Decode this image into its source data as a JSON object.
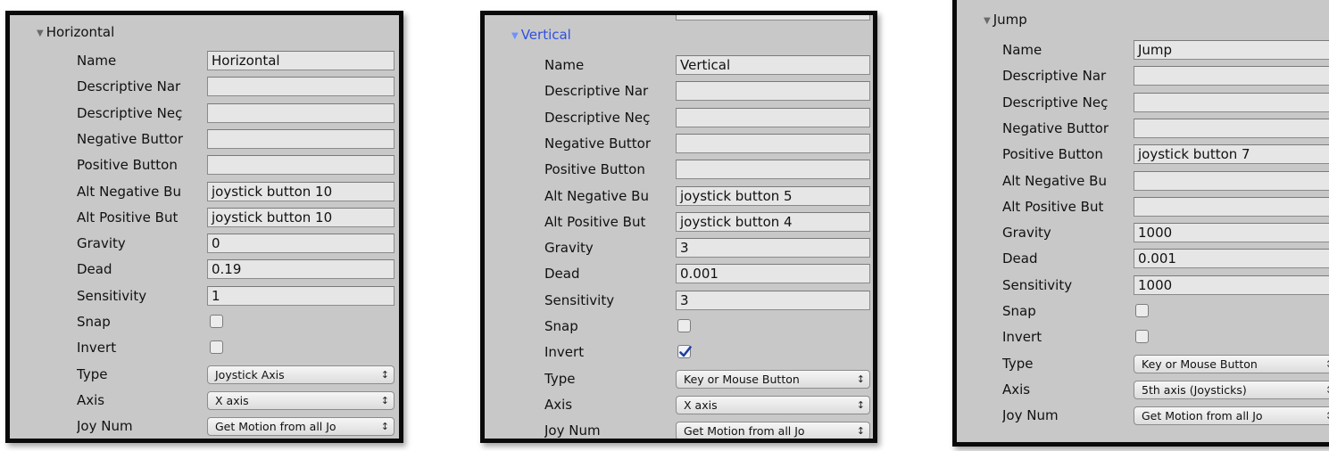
{
  "panels": [
    {
      "header": "Horizontal",
      "header_color": "#111111",
      "rows": [
        {
          "label": "Name",
          "kind": "text",
          "value": "Horizontal"
        },
        {
          "label": "Descriptive Nar",
          "kind": "text",
          "value": ""
        },
        {
          "label": "Descriptive Neç",
          "kind": "text",
          "value": ""
        },
        {
          "label": "Negative Buttor",
          "kind": "text",
          "value": ""
        },
        {
          "label": "Positive Button",
          "kind": "text",
          "value": ""
        },
        {
          "label": "Alt Negative Bu",
          "kind": "text",
          "value": "joystick button 10"
        },
        {
          "label": "Alt Positive But",
          "kind": "text",
          "value": "joystick button 10"
        },
        {
          "label": "Gravity",
          "kind": "text",
          "value": "0"
        },
        {
          "label": "Dead",
          "kind": "text",
          "value": "0.19"
        },
        {
          "label": "Sensitivity",
          "kind": "text",
          "value": "1"
        },
        {
          "label": "Snap",
          "kind": "check",
          "checked": false
        },
        {
          "label": "Invert",
          "kind": "check",
          "checked": false
        },
        {
          "label": "Type",
          "kind": "select",
          "value": "Joystick Axis"
        },
        {
          "label": "Axis",
          "kind": "select",
          "value": "X axis"
        },
        {
          "label": "Joy Num",
          "kind": "select",
          "value": "Get Motion from all Jo"
        }
      ]
    },
    {
      "header": "Vertical",
      "header_color": "#2f4fe0",
      "rows": [
        {
          "label": "Name",
          "kind": "text",
          "value": "Vertical"
        },
        {
          "label": "Descriptive Nar",
          "kind": "text",
          "value": ""
        },
        {
          "label": "Descriptive Neç",
          "kind": "text",
          "value": ""
        },
        {
          "label": "Negative Buttor",
          "kind": "text",
          "value": ""
        },
        {
          "label": "Positive Button",
          "kind": "text",
          "value": ""
        },
        {
          "label": "Alt Negative Bu",
          "kind": "text",
          "value": "joystick button 5"
        },
        {
          "label": "Alt Positive But",
          "kind": "text",
          "value": "joystick button 4"
        },
        {
          "label": "Gravity",
          "kind": "text",
          "value": "3"
        },
        {
          "label": "Dead",
          "kind": "text",
          "value": "0.001"
        },
        {
          "label": "Sensitivity",
          "kind": "text",
          "value": "3"
        },
        {
          "label": "Snap",
          "kind": "check",
          "checked": false
        },
        {
          "label": "Invert",
          "kind": "check",
          "checked": true
        },
        {
          "label": "Type",
          "kind": "select",
          "value": "Key or Mouse Button"
        },
        {
          "label": "Axis",
          "kind": "select",
          "value": "X axis"
        },
        {
          "label": "Joy Num",
          "kind": "select",
          "value": "Get Motion from all Jo"
        }
      ]
    },
    {
      "header": "Jump",
      "header_color": "#111111",
      "rows": [
        {
          "label": "Name",
          "kind": "text",
          "value": "Jump"
        },
        {
          "label": "Descriptive Nar",
          "kind": "text",
          "value": ""
        },
        {
          "label": "Descriptive Neç",
          "kind": "text",
          "value": ""
        },
        {
          "label": "Negative Buttor",
          "kind": "text",
          "value": ""
        },
        {
          "label": "Positive Button",
          "kind": "text",
          "value": "joystick button 7"
        },
        {
          "label": "Alt Negative Bu",
          "kind": "text",
          "value": ""
        },
        {
          "label": "Alt Positive But",
          "kind": "text",
          "value": ""
        },
        {
          "label": "Gravity",
          "kind": "text",
          "value": "1000"
        },
        {
          "label": "Dead",
          "kind": "text",
          "value": "0.001"
        },
        {
          "label": "Sensitivity",
          "kind": "text",
          "value": "1000"
        },
        {
          "label": "Snap",
          "kind": "check",
          "checked": false
        },
        {
          "label": "Invert",
          "kind": "check",
          "checked": false
        },
        {
          "label": "Type",
          "kind": "select",
          "value": "Key or Mouse Button"
        },
        {
          "label": "Axis",
          "kind": "select",
          "value": "5th axis (Joysticks)"
        },
        {
          "label": "Joy Num",
          "kind": "select",
          "value": "Get Motion from all Jo"
        }
      ]
    }
  ],
  "colors": {
    "panel_bg": "#c8c8c8",
    "field_bg": "#e6e6e6",
    "frame": "#0a0a0a",
    "checkmark": "#1f3fa0"
  },
  "icons": {
    "foldout": "triangle-down-icon",
    "select": "up-down-arrows-icon",
    "check": "checkmark-icon"
  }
}
